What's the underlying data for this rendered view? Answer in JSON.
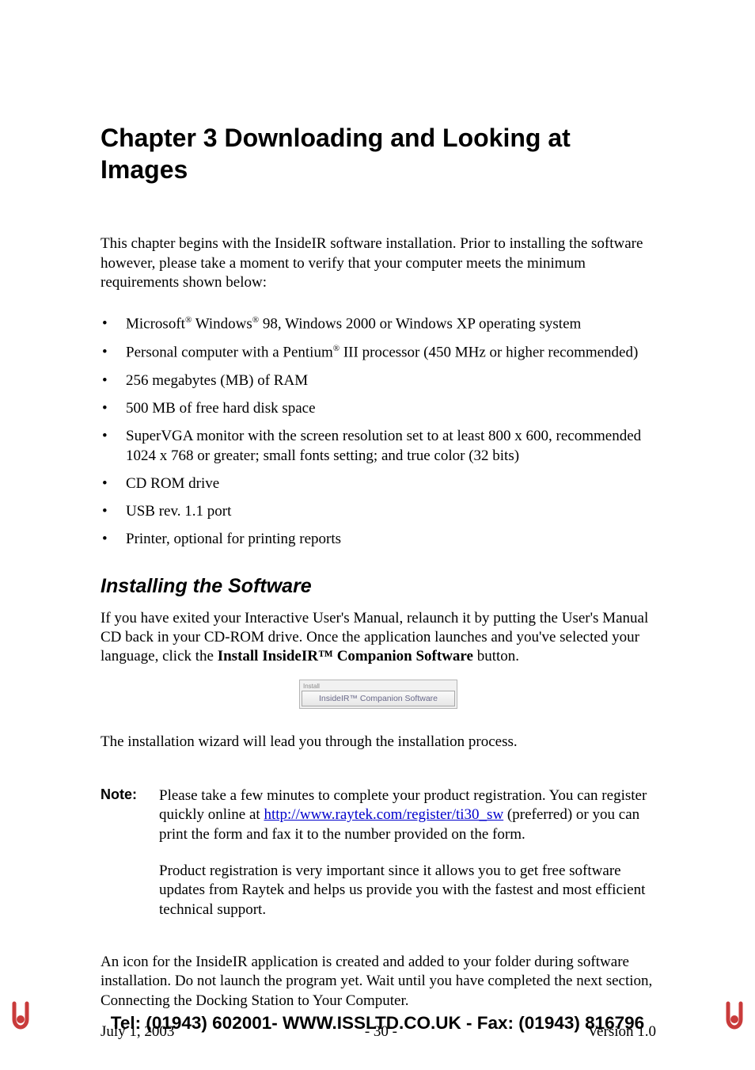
{
  "chapter": {
    "title": "Chapter 3   Downloading and Looking at Images"
  },
  "intro": "This chapter begins with the InsideIR software installation. Prior to installing the software however, please take a moment to verify that your computer meets the minimum requirements shown below:",
  "requirements": [
    {
      "pre": "Microsoft",
      "sup1": "®",
      "mid": " Windows",
      "sup2": "®",
      "post": " 98, Windows 2000 or Windows XP operating system"
    },
    {
      "pre": "Personal computer with a Pentium",
      "sup1": "®",
      "mid": "",
      "sup2": "",
      "post": " III processor (450 MHz or higher recommended)"
    },
    {
      "pre": "256 megabytes (MB) of RAM",
      "sup1": "",
      "mid": "",
      "sup2": "",
      "post": ""
    },
    {
      "pre": "500 MB of free hard disk space",
      "sup1": "",
      "mid": "",
      "sup2": "",
      "post": ""
    },
    {
      "pre": "SuperVGA monitor with the screen resolution set to at least 800 x 600, recommended 1024 x 768 or greater; small fonts setting; and true color (32 bits)",
      "sup1": "",
      "mid": "",
      "sup2": "",
      "post": ""
    },
    {
      "pre": "CD ROM drive",
      "sup1": "",
      "mid": "",
      "sup2": "",
      "post": ""
    },
    {
      "pre": "USB rev. 1.1 port",
      "sup1": "",
      "mid": "",
      "sup2": "",
      "post": ""
    },
    {
      "pre": "Printer, optional for printing reports",
      "sup1": "",
      "mid": "",
      "sup2": "",
      "post": ""
    }
  ],
  "section2": {
    "heading": "Installing the Software",
    "para1_pre": "If you have exited your Interactive User's Manual, relaunch it by putting the User's Manual CD back in your CD-ROM drive. Once the application launches and you've selected your language, click the ",
    "para1_bold": "Install InsideIR™ Companion Software",
    "para1_post": " button."
  },
  "button_image": {
    "top_label": "Install",
    "button_label": "InsideIR™ Companion Software"
  },
  "para_after_button": "The installation wizard will lead you through the installation process.",
  "note": {
    "label": "Note:",
    "p1_pre": "Please take a few minutes to complete your product registration. You can register quickly online at ",
    "p1_link": "http://www.raytek.com/register/ti30_sw",
    "p1_post": " (preferred) or you can print the form and fax it to the number provided on the form.",
    "p2": "Product registration is very important since it allows you to get free software updates from Raytek and helps us provide you with the fastest and most efficient technical support."
  },
  "post_note": "An icon for the InsideIR application is created and added to your folder during software installation. Do not launch the program yet. Wait until you have completed the next section, Connecting the Docking Station to Your Computer.",
  "footer": {
    "date": "July 1, 2003",
    "page": "- 30 -",
    "version": "Version 1.0"
  },
  "banner": {
    "text": "Tel: (01943) 602001- WWW.ISSLTD.CO.UK - Fax: (01943) 816796"
  }
}
